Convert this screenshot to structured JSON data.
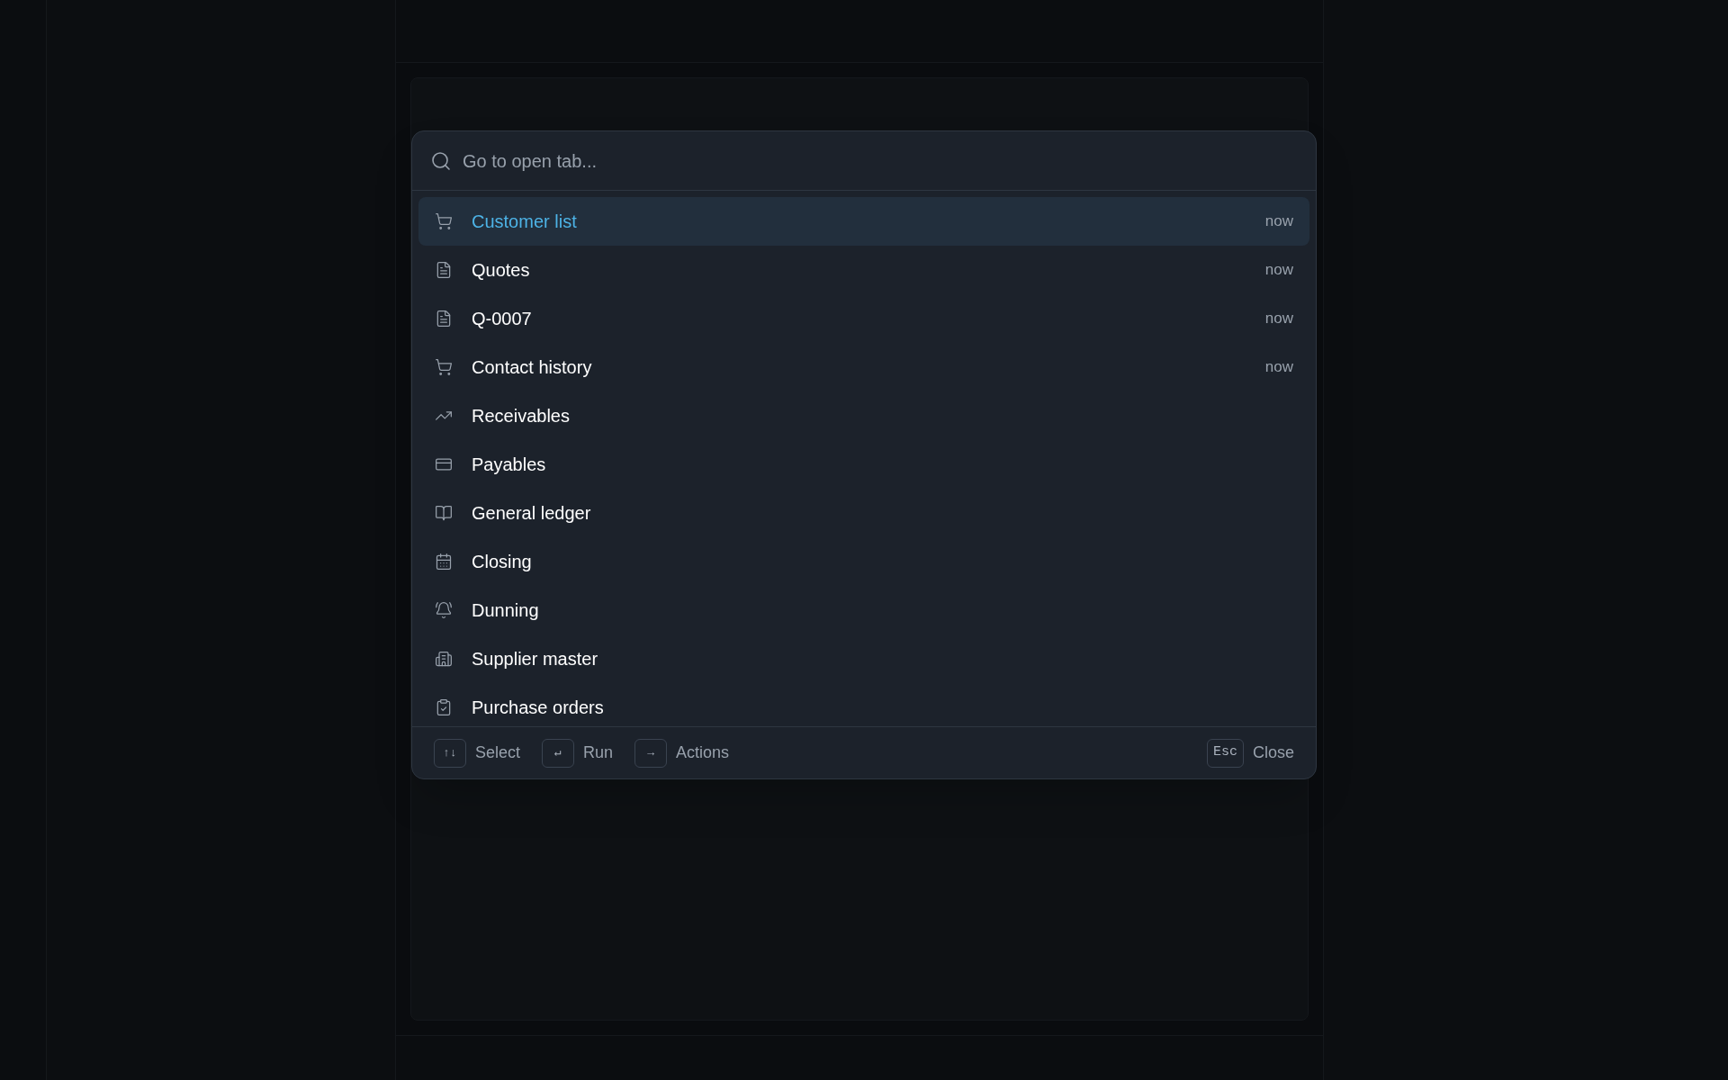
{
  "palette": {
    "search": {
      "placeholder": "Go to open tab..."
    },
    "items": [
      {
        "label": "Customer list",
        "kind": "cart",
        "time": "now",
        "selected": true
      },
      {
        "label": "Quotes",
        "kind": "document",
        "time": "now",
        "selected": false
      },
      {
        "label": "Q-0007",
        "kind": "document",
        "time": "now",
        "selected": false
      },
      {
        "label": "Contact history",
        "kind": "cart",
        "time": "now",
        "selected": false
      },
      {
        "label": "Receivables",
        "kind": "trend",
        "selected": false
      },
      {
        "label": "Payables",
        "kind": "card",
        "selected": false
      },
      {
        "label": "General ledger",
        "kind": "book",
        "selected": false
      },
      {
        "label": "Closing",
        "kind": "calendar",
        "selected": false
      },
      {
        "label": "Dunning",
        "kind": "bell",
        "selected": false
      },
      {
        "label": "Supplier master",
        "kind": "building",
        "selected": false
      },
      {
        "label": "Purchase orders",
        "kind": "clipboard",
        "selected": false
      }
    ],
    "footer": {
      "hints": [
        {
          "key": "↑↓",
          "label": "Select"
        },
        {
          "key": "↵",
          "label": "Run"
        },
        {
          "key": "→",
          "label": "Actions"
        }
      ],
      "close": {
        "key": "Esc",
        "label": "Close"
      }
    }
  }
}
